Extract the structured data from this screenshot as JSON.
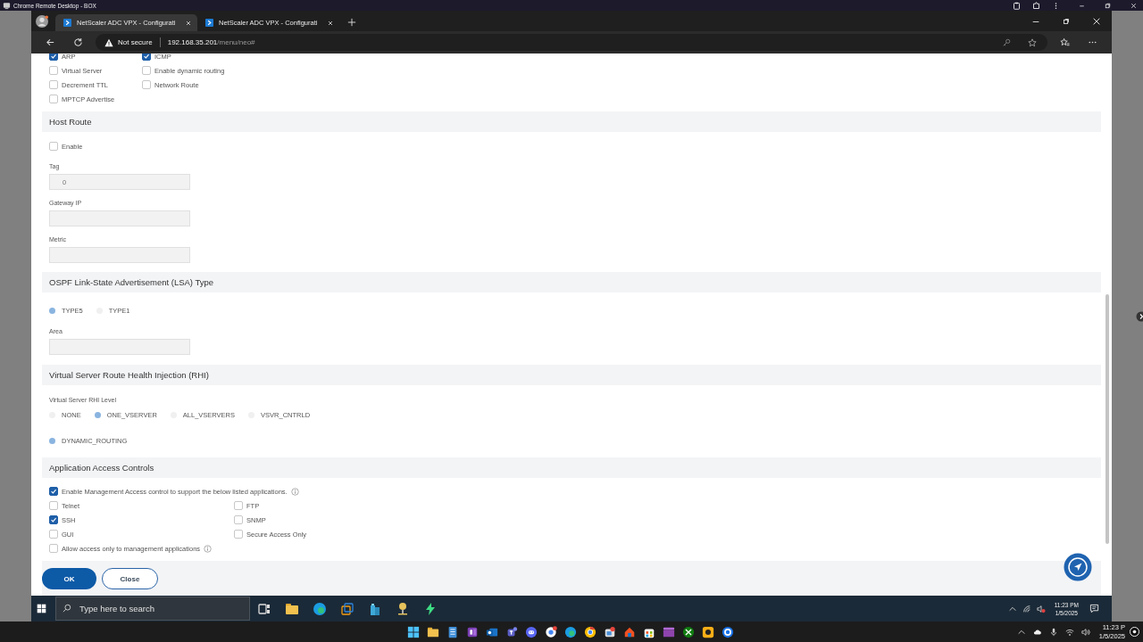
{
  "remote_desktop": {
    "title": "Chrome Remote Desktop - BOX"
  },
  "browser": {
    "tabs": [
      {
        "title": "NetScaler ADC VPX - Configurati",
        "selected": true
      },
      {
        "title": "NetScaler ADC VPX - Configurati",
        "selected": false
      }
    ],
    "address": {
      "security": "Not secure",
      "host": "192.168.35.201",
      "path": "/menu/neo#"
    }
  },
  "form": {
    "options": [
      {
        "label": "ARP",
        "checked": true
      },
      {
        "label": "ICMP",
        "checked": true
      },
      {
        "label": "Virtual Server",
        "checked": false
      },
      {
        "label": "Enable dynamic routing",
        "checked": false
      },
      {
        "label": "Decrement TTL",
        "checked": false
      },
      {
        "label": "Network Route",
        "checked": false
      },
      {
        "label": "MPTCP Advertise",
        "checked": false
      }
    ],
    "host_route": {
      "title": "Host Route",
      "enable": {
        "label": "Enable",
        "checked": false
      },
      "fields": [
        {
          "label": "Tag",
          "value": "0"
        },
        {
          "label": "Gateway IP"
        },
        {
          "label": "Metric"
        }
      ]
    },
    "lsa_type": {
      "title": "OSPF Link-State Advertisement (LSA) Type",
      "choices": [
        {
          "label": "TYPE5",
          "selected": true
        },
        {
          "label": "TYPE1",
          "selected": false
        }
      ],
      "fields": [
        {
          "label": "Area"
        }
      ]
    },
    "rhi": {
      "title": "Virtual Server Route Health Injection (RHI)",
      "level_label": "Virtual Server RHI Level",
      "levels": [
        {
          "label": "NONE",
          "selected": false
        },
        {
          "label": "ONE_VSERVER",
          "selected": true
        },
        {
          "label": "ALL_VSERVERS",
          "selected": false
        },
        {
          "label": "VSVR_CNTRLD",
          "selected": false
        }
      ],
      "dynamic": {
        "label": "DYNAMIC_ROUTING",
        "selected": true
      }
    },
    "access": {
      "title": "Application Access Controls",
      "enable": {
        "label": "Enable Management Access control to support the below listed applications.",
        "checked": true
      },
      "apps": [
        {
          "label": "Telnet",
          "checked": false
        },
        {
          "label": "FTP",
          "checked": false
        },
        {
          "label": "SSH",
          "checked": true
        },
        {
          "label": "SNMP",
          "checked": false
        },
        {
          "label": "GUI",
          "checked": false
        },
        {
          "label": "Secure Access Only",
          "checked": false
        }
      ],
      "restrict": {
        "label": "Allow access only to management applications",
        "checked": false
      }
    },
    "buttons": [
      {
        "label": "OK",
        "kind": "primary"
      },
      {
        "label": "Close",
        "kind": "secondary"
      }
    ]
  },
  "remote_taskbar": {
    "search": {
      "placeholder": "Type here to search"
    },
    "time": "11:23 PM",
    "date": "1/5/2025"
  },
  "local_taskbar": {
    "time": "11:23 P",
    "date": "1/5/2025"
  }
}
